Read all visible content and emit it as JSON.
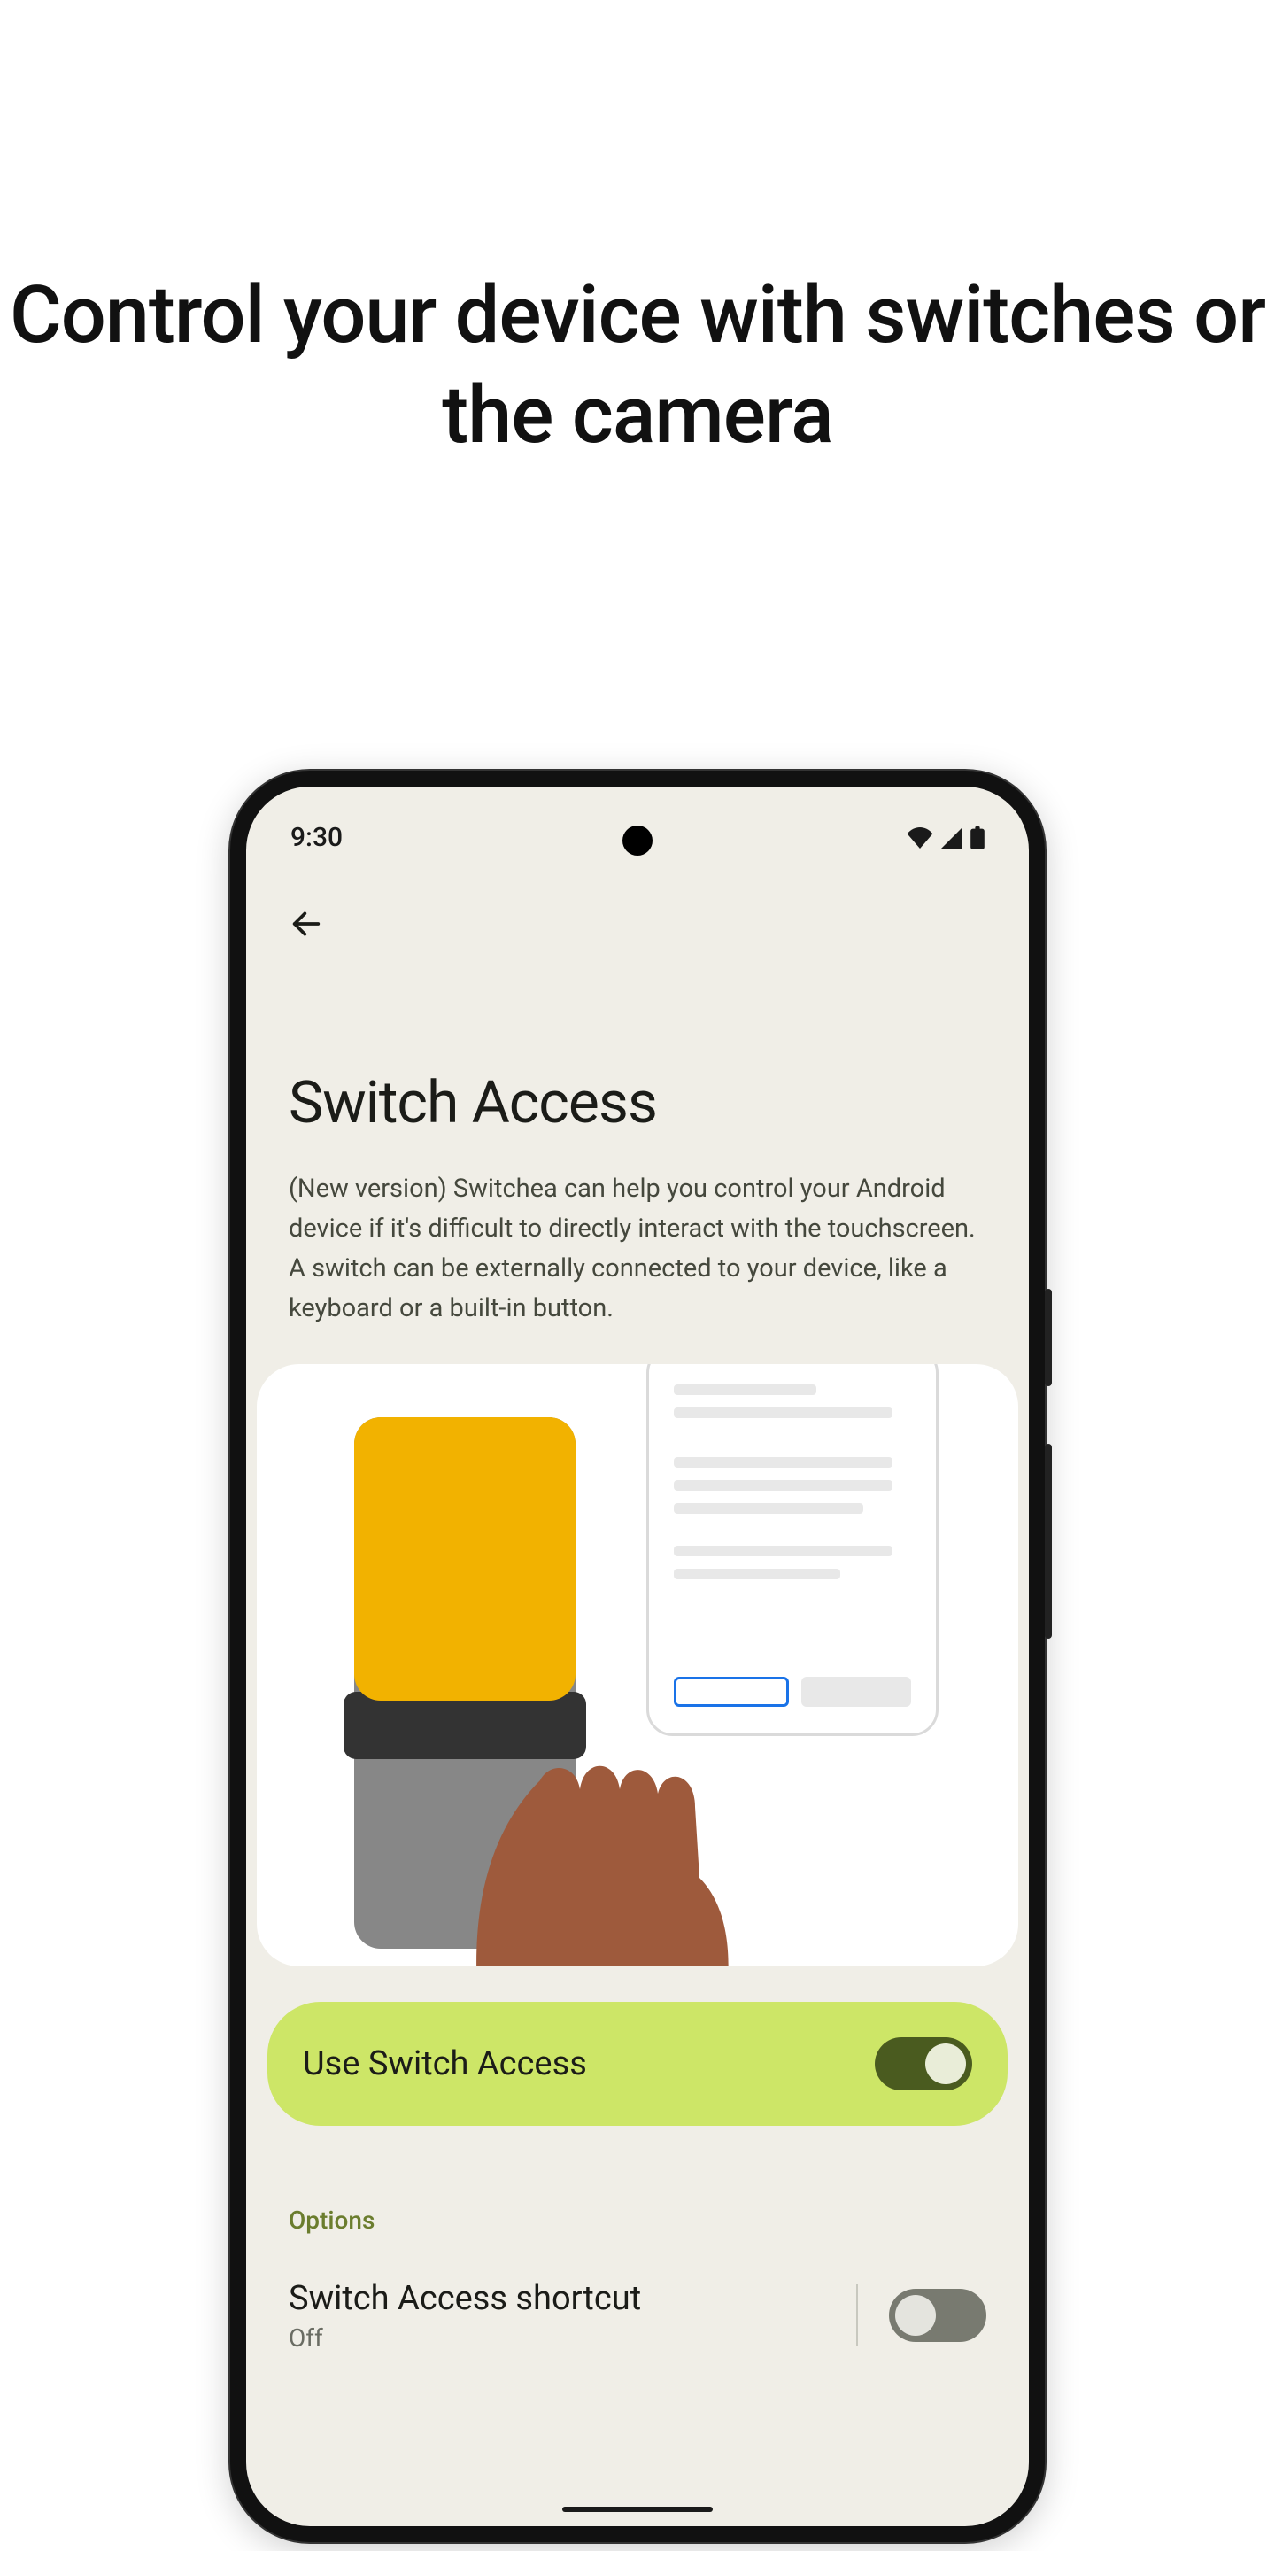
{
  "headline": "Control your device with switches or the camera",
  "status": {
    "time": "9:30"
  },
  "page": {
    "title": "Switch Access",
    "description": "(New version) Switchea can help you control your Android device if it's difficult to directly interact with the touchscreen. A switch can be externally connected to your device, like a keyboard or a built-in button."
  },
  "primaryToggle": {
    "label": "Use Switch Access",
    "on": true
  },
  "options": {
    "sectionLabel": "Options",
    "items": [
      {
        "title": "Switch Access shortcut",
        "subtitle": "Off",
        "on": false
      }
    ]
  }
}
